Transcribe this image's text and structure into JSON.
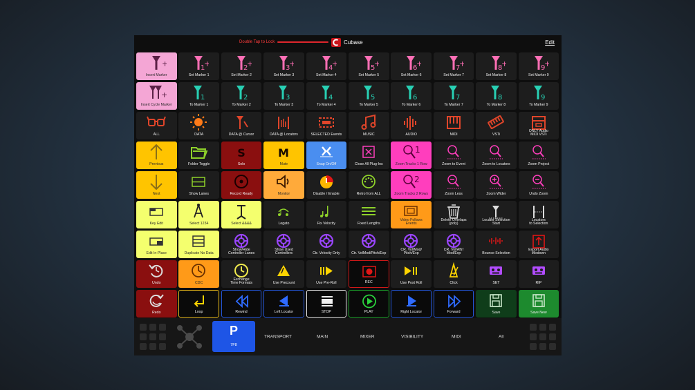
{
  "app": {
    "title": "Cubase",
    "hint": "Double Tap to Lock",
    "edit_label": "Edit"
  },
  "colors": {
    "pink": "#f4a6d5",
    "hotpink": "#ff3ebd",
    "yellow": "#ffc400",
    "orange": "#ff9a18",
    "amber": "#ffaa3a",
    "lime": "#f4ff6e",
    "red": "#8a0f0f",
    "blue": "#4a8ef0",
    "dark": "#1d1d1d"
  },
  "tiles": [
    {
      "label": "Insert Marker",
      "bg": "pink",
      "icon": "marker-plus-icon"
    },
    {
      "label": "Set Marker 1",
      "bg": "dark",
      "icon": "marker-plus-icon"
    },
    {
      "label": "Set Marker 2",
      "bg": "dark",
      "icon": "marker-plus-icon"
    },
    {
      "label": "Set Marker 3",
      "bg": "dark",
      "icon": "marker-plus-icon"
    },
    {
      "label": "Set Marker 4",
      "bg": "dark",
      "icon": "marker-plus-icon"
    },
    {
      "label": "Set Marker 5",
      "bg": "dark",
      "icon": "marker-plus-icon"
    },
    {
      "label": "Set Marker 6",
      "bg": "dark",
      "icon": "marker-plus-icon"
    },
    {
      "label": "Set Marker 7",
      "bg": "dark",
      "icon": "marker-plus-icon"
    },
    {
      "label": "Set Marker 8",
      "bg": "dark",
      "icon": "marker-plus-icon"
    },
    {
      "label": "Set Marker 9",
      "bg": "dark",
      "icon": "marker-plus-icon"
    },
    {
      "label": "Insert Cycle Marker",
      "bg": "pink",
      "icon": "cycle-marker-icon"
    },
    {
      "label": "To Marker 1",
      "bg": "dark",
      "icon": "marker-icon"
    },
    {
      "label": "To Marker 2",
      "bg": "dark",
      "icon": "marker-icon"
    },
    {
      "label": "To Marker 3",
      "bg": "dark",
      "icon": "marker-icon"
    },
    {
      "label": "To Marker 4",
      "bg": "dark",
      "icon": "marker-icon"
    },
    {
      "label": "To Marker 5",
      "bg": "dark",
      "icon": "marker-icon"
    },
    {
      "label": "To Marker 6",
      "bg": "dark",
      "icon": "marker-icon"
    },
    {
      "label": "To Marker 7",
      "bg": "dark",
      "icon": "marker-icon"
    },
    {
      "label": "To Marker 8",
      "bg": "dark",
      "icon": "marker-icon"
    },
    {
      "label": "To Marker 9",
      "bg": "dark",
      "icon": "marker-icon"
    },
    {
      "label": "ALL",
      "bg": "dark",
      "icon": "glasses-icon"
    },
    {
      "label": "DATA",
      "bg": "dark",
      "icon": "sun-icon"
    },
    {
      "label": "DATA @ Cursor",
      "bg": "dark",
      "icon": "cursor-icon"
    },
    {
      "label": "DATA @ Locators",
      "bg": "dark",
      "icon": "locators-icon"
    },
    {
      "label": "SELECTED Events",
      "bg": "dark",
      "icon": "events-icon"
    },
    {
      "label": "MUSIC",
      "bg": "dark",
      "icon": "music-icon"
    },
    {
      "label": "AUDIO",
      "bg": "dark",
      "icon": "waveform-icon"
    },
    {
      "label": "MIDI",
      "bg": "dark",
      "icon": "piano-icon"
    },
    {
      "label": "VSTi",
      "bg": "dark",
      "icon": "keyboard-icon"
    },
    {
      "label": "ONLY Audio\nMIDI VSTi",
      "bg": "dark",
      "icon": "box-icon"
    },
    {
      "label": "Previous",
      "bg": "yellow",
      "icon": "arrow-up-icon"
    },
    {
      "label": "Folder Toggle",
      "bg": "dark",
      "icon": "folder-icon"
    },
    {
      "label": "Solo",
      "bg": "red",
      "icon": "solo-icon"
    },
    {
      "label": "Mute",
      "bg": "yellow",
      "icon": "mute-icon"
    },
    {
      "label": "Snap On/Off",
      "bg": "blue",
      "icon": "snap-icon"
    },
    {
      "label": "Close All Plug-Ins",
      "bg": "dark",
      "icon": "close-window-icon"
    },
    {
      "label": "Zoom Tracks 1 Row",
      "bg": "hotpink",
      "icon": "zoom-1-icon"
    },
    {
      "label": "Zoom to Event",
      "bg": "dark",
      "icon": "zoom-event-icon"
    },
    {
      "label": "Zoom to Locators",
      "bg": "dark",
      "icon": "zoom-locators-icon"
    },
    {
      "label": "Zoom Project",
      "bg": "dark",
      "icon": "zoom-project-icon"
    },
    {
      "label": "Next",
      "bg": "yellow",
      "icon": "arrow-down-icon"
    },
    {
      "label": "Show Lanes",
      "bg": "dark",
      "icon": "lanes-icon"
    },
    {
      "label": "Record Ready",
      "bg": "red",
      "icon": "record-ready-icon"
    },
    {
      "label": "Monitor",
      "bg": "amber",
      "icon": "speaker-icon"
    },
    {
      "label": "Disable / Enable",
      "bg": "dark",
      "icon": "power-icon"
    },
    {
      "label": "Retro from ALL",
      "bg": "dark",
      "icon": "midi-port-icon"
    },
    {
      "label": "Zoom Tracks 2 Rows",
      "bg": "hotpink",
      "icon": "zoom-2-icon"
    },
    {
      "label": "Zoom Less",
      "bg": "dark",
      "icon": "zoom-out-icon"
    },
    {
      "label": "Zoom Wider",
      "bg": "dark",
      "icon": "zoom-in-icon"
    },
    {
      "label": "Undo Zoom",
      "bg": "dark",
      "icon": "undo-zoom-icon"
    },
    {
      "label": "Key Edit",
      "bg": "lime",
      "icon": "key-edit-icon"
    },
    {
      "label": "Select 1234",
      "bg": "lime",
      "icon": "compass-icon"
    },
    {
      "label": "Select &&&&",
      "bg": "lime",
      "icon": "stand-icon"
    },
    {
      "label": "Legato",
      "bg": "dark",
      "icon": "legato-icon"
    },
    {
      "label": "Fix Velocity",
      "bg": "dark",
      "icon": "velocity-icon"
    },
    {
      "label": "Fixed Lengths",
      "bg": "dark",
      "icon": "lines-icon"
    },
    {
      "label": "Video Follows\nEvents",
      "bg": "orange",
      "icon": "video-icon"
    },
    {
      "label": "Delete Overlaps\n(poly)",
      "bg": "dark",
      "icon": "trash-icon"
    },
    {
      "label": "Locator Selection\nStart",
      "bg": "dark",
      "icon": "locator-start-icon"
    },
    {
      "label": "Locators\nto Selection",
      "bg": "dark",
      "icon": "locator-sel-icon"
    },
    {
      "label": "Edit In-Place",
      "bg": "lime",
      "icon": "edit-inplace-icon"
    },
    {
      "label": "Duplicate No Data",
      "bg": "lime",
      "icon": "duplicate-icon"
    },
    {
      "label": "Show/Hide\nController Lanes",
      "bg": "dark",
      "icon": "ring-icon"
    },
    {
      "label": "Show Used\nControllers",
      "bg": "dark",
      "icon": "ring-icon"
    },
    {
      "label": "Ctr. Velocity Only",
      "bg": "dark",
      "icon": "ring-icon"
    },
    {
      "label": "Ctr. VelMod/Pitch/Exp",
      "bg": "dark",
      "icon": "ring-icon"
    },
    {
      "label": "CR. Vol/Mod/\nPitch/Exp",
      "bg": "dark",
      "icon": "ring-icon"
    },
    {
      "label": "CR. Vol/Aftr/\nMod/Exp",
      "bg": "dark",
      "icon": "ring-icon"
    },
    {
      "label": "Bounce Selection",
      "bg": "dark",
      "icon": "bounce-icon"
    },
    {
      "label": "Export Audio\nMixdown",
      "bg": "dark",
      "icon": "export-icon"
    },
    {
      "label": "Undo",
      "bg": "red",
      "icon": "undo-icon"
    },
    {
      "label": "CDC",
      "bg": "orange",
      "icon": "cdc-icon"
    },
    {
      "label": "Exchange\nTime Formats",
      "bg": "dark",
      "icon": "clock-icon"
    },
    {
      "label": "Use Precount",
      "bg": "dark",
      "icon": "precount-icon"
    },
    {
      "label": "Use Pre-Roll",
      "bg": "dark",
      "icon": "preroll-icon"
    },
    {
      "label": "REC",
      "bg": "black",
      "icon": "rec-icon",
      "border": "#d01818"
    },
    {
      "label": "Use Post Roll",
      "bg": "dark",
      "icon": "postroll-icon"
    },
    {
      "label": "Click",
      "bg": "dark",
      "icon": "metronome-icon"
    },
    {
      "label": "SET",
      "bg": "dark",
      "icon": "cassette-icon"
    },
    {
      "label": "RIP",
      "bg": "dark",
      "icon": "cassette-icon"
    },
    {
      "label": "Redo",
      "bg": "red",
      "icon": "redo-icon"
    },
    {
      "label": "Loop",
      "bg": "black",
      "icon": "loop-icon",
      "border": "#e3b51a"
    },
    {
      "label": "Rewind",
      "bg": "black",
      "icon": "rewind-icon",
      "border": "#2456d8"
    },
    {
      "label": "Left Locator",
      "bg": "black",
      "icon": "left-locator-icon",
      "border": "#2456d8"
    },
    {
      "label": "STOP",
      "bg": "black",
      "icon": "stop-icon",
      "border": "#e8e8e8"
    },
    {
      "label": "PLAY",
      "bg": "black",
      "icon": "play-icon",
      "border": "#1ba12a"
    },
    {
      "label": "Right Locator",
      "bg": "black",
      "icon": "right-locator-icon",
      "border": "#2456d8"
    },
    {
      "label": "Forward",
      "bg": "black",
      "icon": "forward-icon",
      "border": "#2456d8"
    },
    {
      "label": "Save",
      "bg": "darkgreen",
      "icon": "save-icon"
    },
    {
      "label": "Save New",
      "bg": "green",
      "icon": "save-icon"
    }
  ],
  "marker_numbers": [
    "1",
    "2",
    "3",
    "4",
    "5",
    "6",
    "7",
    "8",
    "9"
  ],
  "tile_glyphs": {
    "solo": "S",
    "mute": "M",
    "zoom1": "1",
    "zoom2": "2"
  },
  "bottom_nav": {
    "active_button": {
      "glyph": "P",
      "label": "7F8"
    },
    "tabs": [
      "TRANSPORT",
      "MAIN",
      "MIXER",
      "VISIBILITY",
      "MIDI",
      "All"
    ]
  }
}
